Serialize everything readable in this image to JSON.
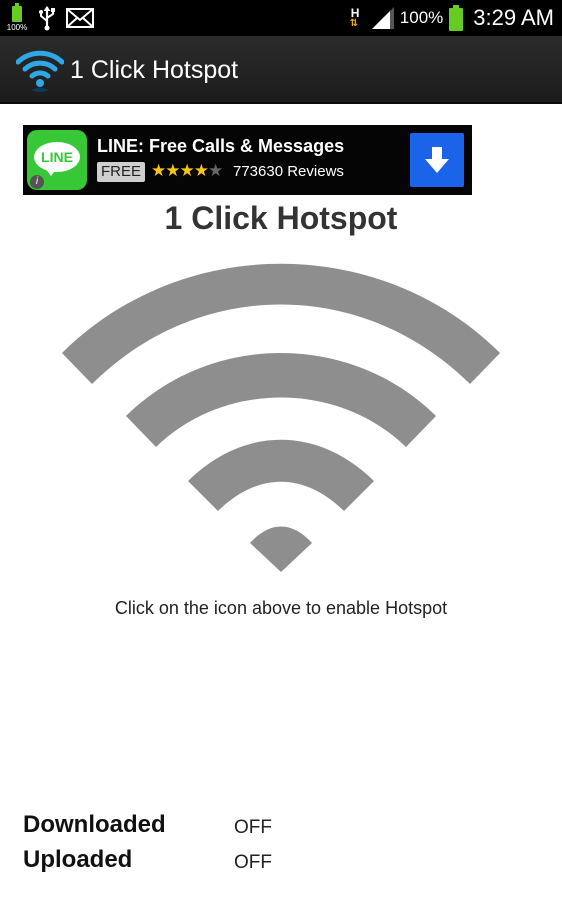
{
  "status_bar": {
    "small_battery_text": "100%",
    "battery_percent": "100%",
    "network_type": "H",
    "time": "3:29 AM"
  },
  "action_bar": {
    "title": "1 Click Hotspot",
    "icon": "wifi-icon"
  },
  "ad": {
    "app_icon_text": "LINE",
    "title": "LINE: Free Calls & Messages",
    "price": "FREE",
    "rating": 4,
    "rating_max": 5,
    "reviews": "773630 Reviews",
    "info_icon": "info-icon",
    "download_icon": "download-icon"
  },
  "main": {
    "heading": "1 Click Hotspot",
    "wifi_icon": "wifi-icon",
    "instruction": "Click on the icon above to enable Hotspot"
  },
  "stats": [
    {
      "label": "Downloaded",
      "value": "OFF"
    },
    {
      "label": "Uploaded",
      "value": "OFF"
    }
  ],
  "colors": {
    "wifi_gray": "#8e8e8e",
    "ad_download_blue": "#1b63e8",
    "line_green": "#37c737",
    "battery_green": "#66cc22"
  }
}
